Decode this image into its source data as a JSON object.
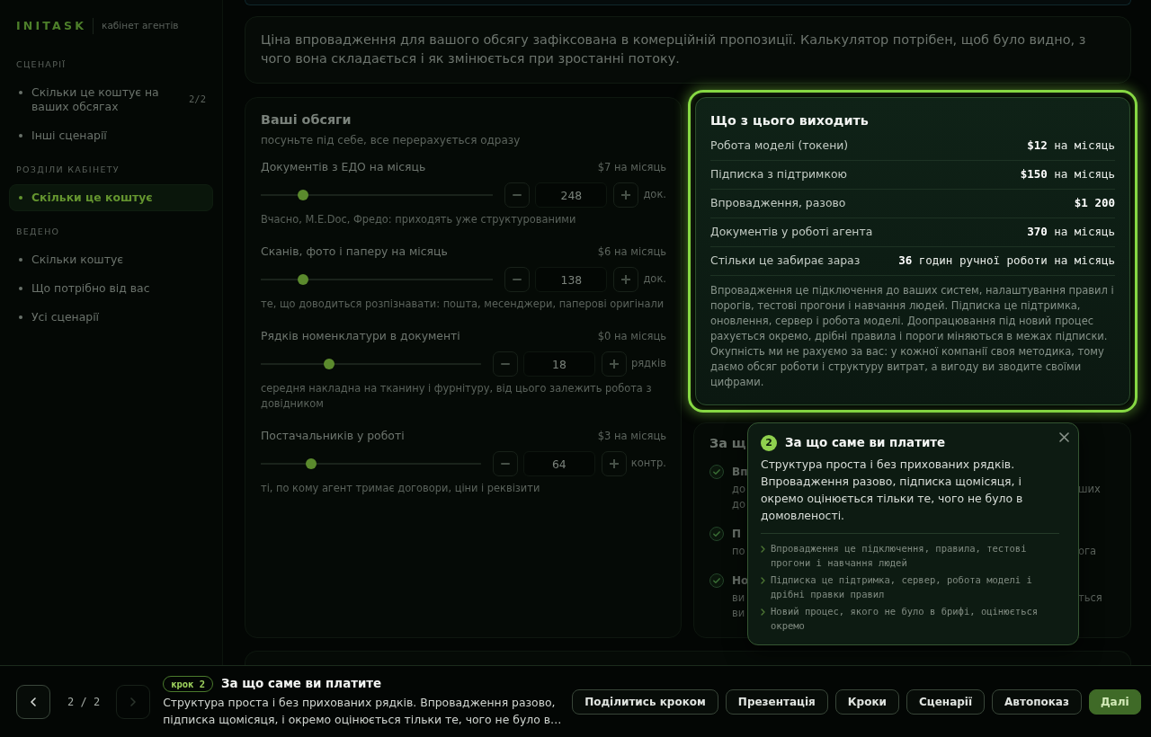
{
  "sidebar": {
    "logo": "INITASK",
    "subtitle": "кабінет агентів",
    "sections": [
      {
        "title": "СЦЕНАРІЇ",
        "items": [
          {
            "label": "Скільки це коштує на ваших обсягах",
            "count": "2/2",
            "selected": false
          },
          {
            "label": "Інші сценарії",
            "selected": false
          }
        ]
      },
      {
        "title": "РОЗДІЛИ КАБІНЕТУ",
        "items": [
          {
            "label": "Скільки це коштує",
            "selected": true
          }
        ]
      },
      {
        "title": "ВЕДЕНО",
        "items": [
          {
            "label": "Скільки коштує",
            "selected": false
          },
          {
            "label": "Що потрібно від вас",
            "selected": false
          },
          {
            "label": "Усі сценарії",
            "selected": false
          }
        ]
      }
    ]
  },
  "intro": {
    "text": "Ціна впровадження для вашого обсягу зафіксована в комерційній пропозиції. Калькулятор потрібен, щоб було видно, з чого вона складається і як змінюється при зростанні потоку."
  },
  "volumes": {
    "title": "Ваші обсяги",
    "subtitle": "посуньте під себе, все перерахується одразу",
    "sliders": [
      {
        "label": "Документів з ЕДО на місяць",
        "cost": "$7 на місяць",
        "level": 0.18,
        "value": "248",
        "unit": "док.",
        "hint": "Вчасно, M.E.Doc, Фредо: приходять уже структурованими"
      },
      {
        "label": "Сканів, фото і паперу на місяць",
        "cost": "$6 на місяць",
        "level": 0.18,
        "value": "138",
        "unit": "док.",
        "hint": "те, що доводиться розпізнавати: пошта, месенджери, паперові оригінали"
      },
      {
        "label": "Рядків номенклатури в документі",
        "cost": "$0 на місяць",
        "level": 0.31,
        "value": "18",
        "unit": "рядків",
        "hint": "середня накладна на тканину і фурнітуру, від цього залежить робота з довідником"
      },
      {
        "label": "Постачальників у роботі",
        "cost": "$3 на місяць",
        "level": 0.23,
        "value": "64",
        "unit": "контр.",
        "hint": "ті, по кому агент тримає договори, ціни і реквізити"
      }
    ]
  },
  "summary": {
    "title": "Що з цього виходить",
    "highlighted": true,
    "rows": [
      {
        "label": "Робота моделі (токени)",
        "value": "**$12** на місяць"
      },
      {
        "label": "Підписка з підтримкою",
        "value": "**$150** на місяць"
      },
      {
        "label": "Впровадження, разово",
        "value": "**$1 200**"
      },
      {
        "label": "Документів у роботі агента",
        "value": "**370** на місяць"
      },
      {
        "label": "Стільки це забирає зараз",
        "value": "**36** годин ручної роботи на місяць"
      }
    ],
    "note": "Впровадження це підключення до ваших систем, налаштування правил і порогів, тестові прогони і навчання людей. Підписка це підтримка, оновлення, сервер і робота моделі. Доопрацювання під новий процес рахується окремо, дрібні правила і пороги міняються в межах підписки. Окупність ми не рахуємо за вас: у кожної компанії своя методика, тому даємо обсяг роботи і структуру витрат, а вигоду ви зводите своїми цифрами."
  },
  "pricing_card": {
    "title": "За щ",
    "items": [
      {
        "title": "Вп",
        "lines": [
          {
            "start": "до",
            "end": "ших"
          },
          {
            "start": "до"
          }
        ]
      },
      {
        "title": "П",
        "lines": [
          {
            "start": "по",
            "end": "ога"
          }
        ]
      },
      {
        "title": "Но",
        "lines": [
          {
            "start": "ви",
            "end": "ться"
          },
          {
            "start": "ви"
          }
        ]
      }
    ]
  },
  "popover": {
    "step": "2",
    "title": "За що саме ви платите",
    "body": "Структура проста і без прихованих рядків. Впровадження разово, підписка щомісяця, і окремо оцінюється тільки те, чого не було в домовленості.",
    "points": [
      "Впровадження це підключення, правила, тестові прогони і навчання людей",
      "Підписка це підтримка, сервер, робота моделі і дрібні правки правил",
      "Новий процес, якого не було в брифі, оцінюється окремо"
    ]
  },
  "tour_bar": {
    "prev": {
      "disabled": false
    },
    "position": "2 / 2",
    "next": {
      "disabled": true
    },
    "badge": "крок 2",
    "title": "За що саме ви платите",
    "description": "Структура проста і без прихованих рядків. Впровадження разово, підписка щомісяця, і окремо оцінюється тільки те, чого не було в…",
    "buttons": [
      {
        "label": "Поділитись кроком",
        "kind": "secondary"
      },
      {
        "label": "Презентація",
        "kind": "secondary"
      },
      {
        "label": "Кроки",
        "kind": "secondary"
      },
      {
        "label": "Сценарії",
        "kind": "secondary"
      },
      {
        "label": "Автопоказ",
        "kind": "secondary"
      },
      {
        "label": "Далі",
        "kind": "primary"
      }
    ]
  }
}
